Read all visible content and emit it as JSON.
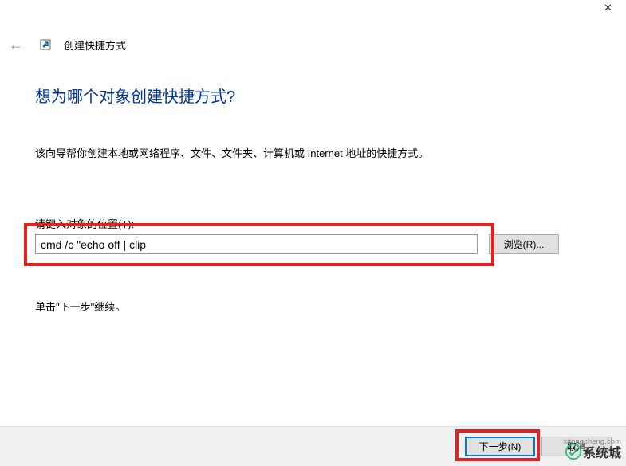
{
  "titlebar": {
    "close_glyph": "✕"
  },
  "header": {
    "back_glyph": "←",
    "window_title": "创建快捷方式"
  },
  "content": {
    "heading": "想为哪个对象创建快捷方式?",
    "description": "该向导帮你创建本地或网络程序、文件、文件夹、计算机或 Internet 地址的快捷方式。",
    "field_label": "请键入对象的位置(T):",
    "location_value": "cmd /c \"echo off | clip",
    "browse_label": "浏览(R)...",
    "hint": "单击\"下一步\"继续。"
  },
  "footer": {
    "next_label": "下一步(N)",
    "cancel_label": "取消"
  },
  "watermark": {
    "cn": "系统城",
    "url": "xitongcheng.com"
  }
}
